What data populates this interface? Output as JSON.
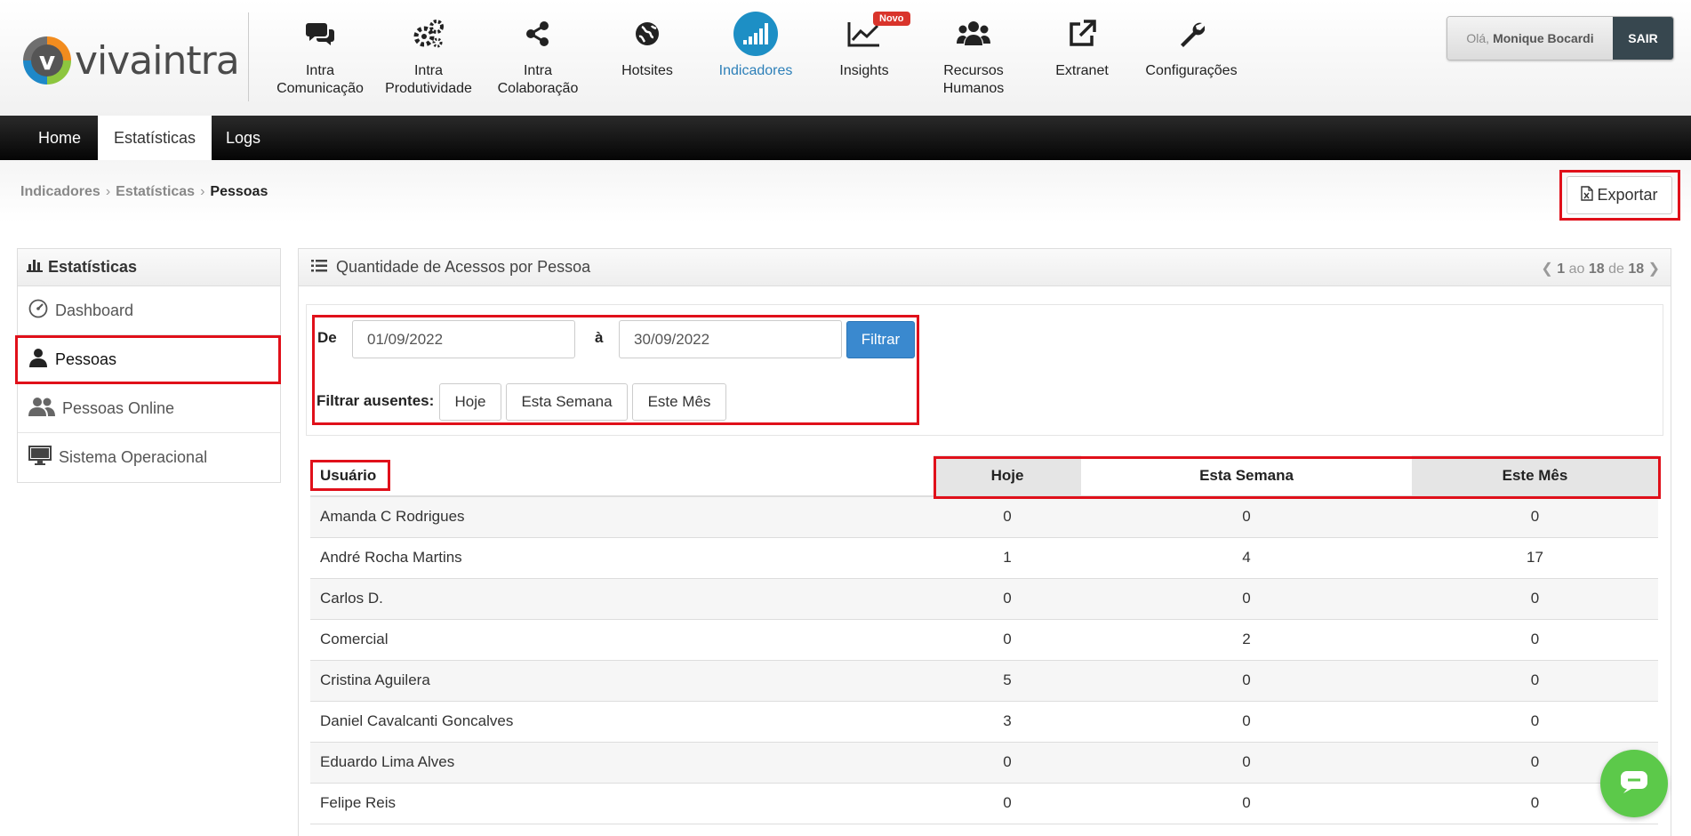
{
  "brand": {
    "logo_letter": "v",
    "logo_text": "vivaintra"
  },
  "top_nav": [
    {
      "line1": "Intra",
      "line2": "Comunicação",
      "icon": "comments-icon"
    },
    {
      "line1": "Intra",
      "line2": "Produtividade",
      "icon": "gears-icon"
    },
    {
      "line1": "Intra",
      "line2": "Colaboração",
      "icon": "share-icon"
    },
    {
      "line1": "Hotsites",
      "line2": "",
      "icon": "globe-icon"
    },
    {
      "line1": "Indicadores",
      "line2": "",
      "icon": "signal-bars-icon",
      "active": true
    },
    {
      "line1": "Insights",
      "line2": "",
      "icon": "line-chart-icon",
      "badge": "Novo"
    },
    {
      "line1": "Recursos",
      "line2": "Humanos",
      "icon": "users-icon"
    },
    {
      "line1": "Extranet",
      "line2": "",
      "icon": "external-link-icon"
    },
    {
      "line1": "Configurações",
      "line2": "",
      "icon": "wrench-icon"
    }
  ],
  "user": {
    "greeting": "Olá,",
    "name": "Monique Bocardi",
    "logout_label": "SAIR"
  },
  "sub_nav": {
    "items": [
      "Home",
      "Estatísticas",
      "Logs"
    ],
    "active": "Estatísticas"
  },
  "breadcrumb": [
    "Indicadores",
    "Estatísticas",
    "Pessoas"
  ],
  "export_label": "Exportar",
  "sidebar": {
    "title": "Estatísticas",
    "items": [
      {
        "label": "Dashboard",
        "icon": "dashboard-icon"
      },
      {
        "label": "Pessoas",
        "icon": "user-icon",
        "active": true
      },
      {
        "label": "Pessoas Online",
        "icon": "users-icon"
      },
      {
        "label": "Sistema Operacional",
        "icon": "monitor-icon"
      }
    ]
  },
  "panel": {
    "title": "Quantidade de Acessos por Pessoa",
    "pager": {
      "from": "1",
      "to_word": "ao",
      "to": "18",
      "of_word": "de",
      "total": "18"
    }
  },
  "filter": {
    "from_label": "De",
    "from_value": "01/09/2022",
    "to_label": "à",
    "to_value": "30/09/2022",
    "submit_label": "Filtrar",
    "absent_label": "Filtrar ausentes:",
    "absent_buttons": [
      "Hoje",
      "Esta Semana",
      "Este Mês"
    ]
  },
  "table": {
    "columns": [
      "Usuário",
      "Hoje",
      "Esta Semana",
      "Este Mês"
    ],
    "rows": [
      [
        "Amanda C Rodrigues",
        "0",
        "0",
        "0"
      ],
      [
        "André Rocha Martins",
        "1",
        "4",
        "17"
      ],
      [
        "Carlos D.",
        "0",
        "0",
        "0"
      ],
      [
        "Comercial",
        "0",
        "2",
        "0"
      ],
      [
        "Cristina Aguilera",
        "5",
        "0",
        "0"
      ],
      [
        "Daniel Cavalcanti Goncalves",
        "3",
        "0",
        "0"
      ],
      [
        "Eduardo Lima Alves",
        "0",
        "0",
        "0"
      ],
      [
        "Felipe Reis",
        "0",
        "0",
        "0"
      ]
    ]
  },
  "colors": {
    "accent": "#1d8fc5",
    "highlight": "#e0101a",
    "chat": "#5cc94a"
  }
}
